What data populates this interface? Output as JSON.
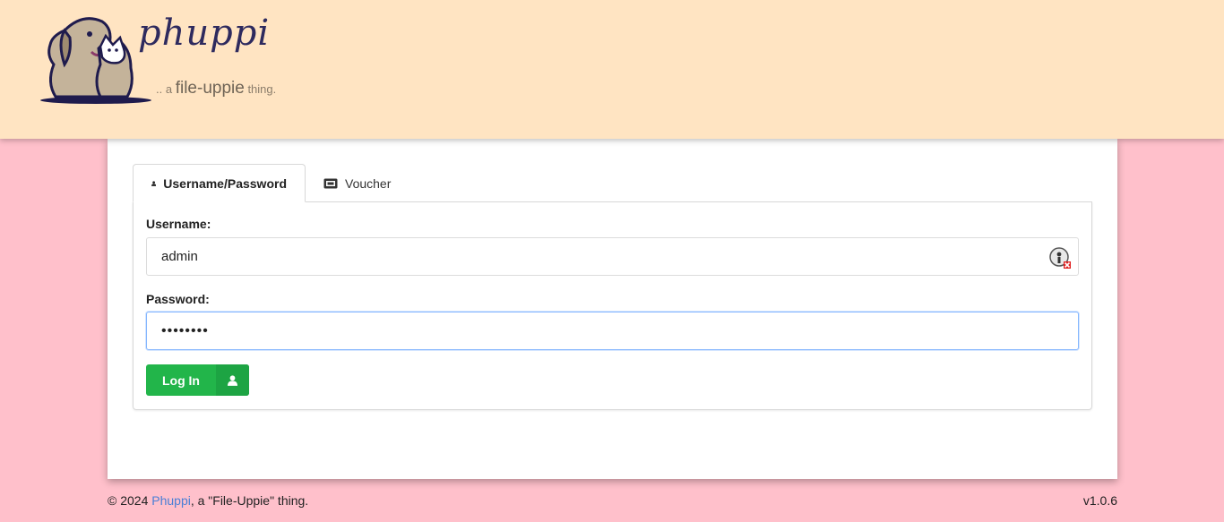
{
  "header": {
    "logo_word": "phuppi",
    "tagline_prefix": ".. a",
    "tagline_brand": "file-uppie",
    "tagline_suffix": "thing."
  },
  "tabs": [
    {
      "label": "Username/Password",
      "icon": "user-icon",
      "active": true
    },
    {
      "label": "Voucher",
      "icon": "ticket-icon",
      "active": false
    }
  ],
  "form": {
    "username_label": "Username:",
    "username_value": "admin",
    "password_label": "Password:",
    "password_value": "••••••••",
    "login_label": "Log In"
  },
  "footer": {
    "copyright": "© 2024",
    "link_text": "Phuppi",
    "suffix": ", a \"File-Uppie\" thing.",
    "version": "v1.0.6"
  },
  "colors": {
    "page_bg": "#ffc0cb",
    "header_bg": "#ffe4c2",
    "button": "#22b54a",
    "link": "#4a7fd6"
  }
}
